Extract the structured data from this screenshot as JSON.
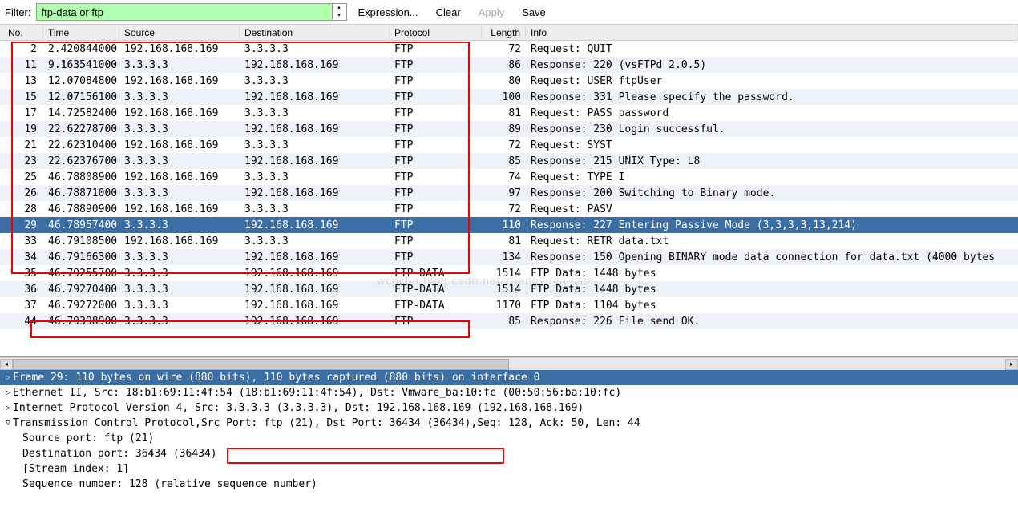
{
  "toolbar": {
    "filter_label": "Filter:",
    "filter_value": "ftp-data or ftp",
    "expression": "Expression...",
    "clear": "Clear",
    "apply": "Apply",
    "save": "Save"
  },
  "columns": {
    "no": "No.",
    "time": "Time",
    "source": "Source",
    "destination": "Destination",
    "protocol": "Protocol",
    "length": "Length",
    "info": "Info"
  },
  "packets": [
    {
      "no": "2",
      "time": "2.420844000",
      "src": "192.168.168.169",
      "dst": "3.3.3.3",
      "proto": "FTP",
      "len": "72",
      "info": "Request: QUIT"
    },
    {
      "no": "11",
      "time": "9.163541000",
      "src": "3.3.3.3",
      "dst": "192.168.168.169",
      "proto": "FTP",
      "len": "86",
      "info": "Response: 220 (vsFTPd 2.0.5)"
    },
    {
      "no": "13",
      "time": "12.07084800",
      "src": "192.168.168.169",
      "dst": "3.3.3.3",
      "proto": "FTP",
      "len": "80",
      "info": "Request: USER ftpUser"
    },
    {
      "no": "15",
      "time": "12.07156100",
      "src": "3.3.3.3",
      "dst": "192.168.168.169",
      "proto": "FTP",
      "len": "100",
      "info": "Response: 331 Please specify the password."
    },
    {
      "no": "17",
      "time": "14.72582400",
      "src": "192.168.168.169",
      "dst": "3.3.3.3",
      "proto": "FTP",
      "len": "81",
      "info": "Request: PASS password"
    },
    {
      "no": "19",
      "time": "22.62278700",
      "src": "3.3.3.3",
      "dst": "192.168.168.169",
      "proto": "FTP",
      "len": "89",
      "info": "Response: 230 Login successful."
    },
    {
      "no": "21",
      "time": "22.62310400",
      "src": "192.168.168.169",
      "dst": "3.3.3.3",
      "proto": "FTP",
      "len": "72",
      "info": "Request: SYST"
    },
    {
      "no": "23",
      "time": "22.62376700",
      "src": "3.3.3.3",
      "dst": "192.168.168.169",
      "proto": "FTP",
      "len": "85",
      "info": "Response: 215 UNIX Type: L8"
    },
    {
      "no": "25",
      "time": "46.78808900",
      "src": "192.168.168.169",
      "dst": "3.3.3.3",
      "proto": "FTP",
      "len": "74",
      "info": "Request: TYPE I"
    },
    {
      "no": "26",
      "time": "46.78871000",
      "src": "3.3.3.3",
      "dst": "192.168.168.169",
      "proto": "FTP",
      "len": "97",
      "info": "Response: 200 Switching to Binary mode."
    },
    {
      "no": "28",
      "time": "46.78890900",
      "src": "192.168.168.169",
      "dst": "3.3.3.3",
      "proto": "FTP",
      "len": "72",
      "info": "Request: PASV"
    },
    {
      "no": "29",
      "time": "46.78957400",
      "src": "3.3.3.3",
      "dst": "192.168.168.169",
      "proto": "FTP",
      "len": "110",
      "info": "Response: 227 Entering Passive Mode (3,3,3,3,13,214)",
      "selected": true
    },
    {
      "no": "33",
      "time": "46.79108500",
      "src": "192.168.168.169",
      "dst": "3.3.3.3",
      "proto": "FTP",
      "len": "81",
      "info": "Request: RETR data.txt"
    },
    {
      "no": "34",
      "time": "46.79166300",
      "src": "3.3.3.3",
      "dst": "192.168.168.169",
      "proto": "FTP",
      "len": "134",
      "info": "Response: 150 Opening BINARY mode data connection for data.txt (4000 bytes"
    },
    {
      "no": "35",
      "time": "46.79255700",
      "src": "3.3.3.3",
      "dst": "192.168.168.169",
      "proto": "FTP-DATA",
      "len": "1514",
      "info": "FTP Data: 1448 bytes"
    },
    {
      "no": "36",
      "time": "46.79270400",
      "src": "3.3.3.3",
      "dst": "192.168.168.169",
      "proto": "FTP-DATA",
      "len": "1514",
      "info": "FTP Data: 1448 bytes"
    },
    {
      "no": "37",
      "time": "46.79272000",
      "src": "3.3.3.3",
      "dst": "192.168.168.169",
      "proto": "FTP-DATA",
      "len": "1170",
      "info": "FTP Data: 1104 bytes"
    },
    {
      "no": "44",
      "time": "46.79398900",
      "src": "3.3.3.3",
      "dst": "192.168.168.169",
      "proto": "FTP",
      "len": "85",
      "info": "Response: 226 File send OK."
    }
  ],
  "details": {
    "frame": "Frame 29: 110 bytes on wire (880 bits), 110 bytes captured (880 bits) on interface 0",
    "eth": "Ethernet II, Src: 18:b1:69:11:4f:54 (18:b1:69:11:4f:54), Dst: Vmware_ba:10:fc (00:50:56:ba:10:fc)",
    "ip": "Internet Protocol Version 4, Src: 3.3.3.3 (3.3.3.3), Dst: 192.168.168.169 (192.168.168.169)",
    "tcp_pre": "Transmission Control Protocol,",
    "tcp_mid": " Src Port: ftp (21), Dst Port: 36434 (36434),",
    "tcp_post": " Seq: 128, Ack: 50, Len: 44",
    "srcport": "Source port: ftp (21)",
    "dstport": "Destination port: 36434 (36434)",
    "stream": "[Stream index: 1]",
    "seq": "Sequence number: 128    (relative sequence number)"
  },
  "watermark": "wcpcha.blog.csdn.net/zhengyuan:csdn"
}
